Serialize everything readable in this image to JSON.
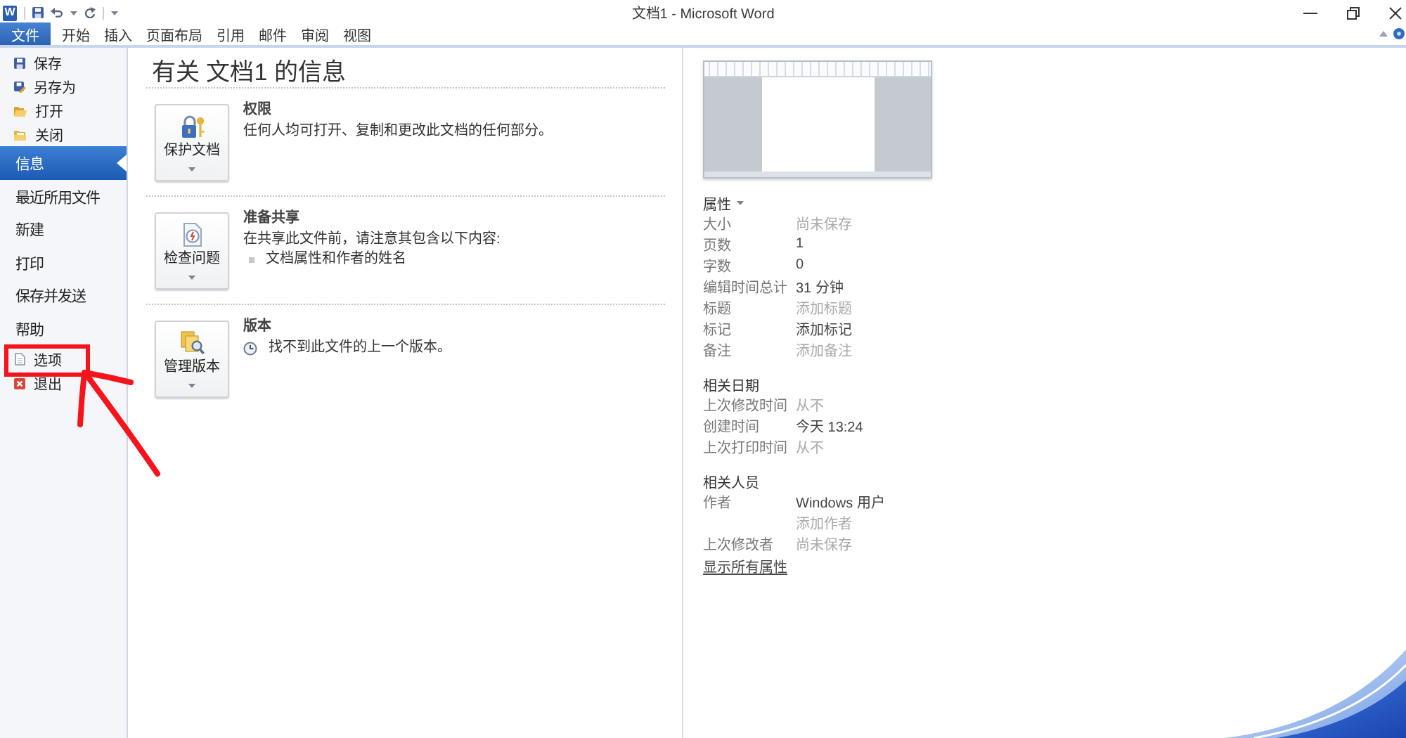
{
  "window": {
    "app_logo": "W",
    "title": "文档1 - Microsoft Word"
  },
  "ribbon_tabs": [
    {
      "label": "文件",
      "selected": true
    },
    {
      "label": "开始",
      "selected": false
    },
    {
      "label": "插入",
      "selected": false
    },
    {
      "label": "页面布局",
      "selected": false
    },
    {
      "label": "引用",
      "selected": false
    },
    {
      "label": "邮件",
      "selected": false
    },
    {
      "label": "审阅",
      "selected": false
    },
    {
      "label": "视图",
      "selected": false
    }
  ],
  "backstage_menu": [
    {
      "label": "保存",
      "kind": "save",
      "selected": false,
      "annotated": false
    },
    {
      "label": "另存为",
      "kind": "saveas",
      "selected": false,
      "annotated": false
    },
    {
      "label": "打开",
      "kind": "open",
      "selected": false,
      "annotated": false
    },
    {
      "label": "关闭",
      "kind": "close",
      "selected": false,
      "annotated": false
    },
    {
      "label": "信息",
      "kind": "page",
      "selected": true,
      "annotated": false
    },
    {
      "label": "最近所用文件",
      "kind": "page",
      "selected": false,
      "annotated": false
    },
    {
      "label": "新建",
      "kind": "page",
      "selected": false,
      "annotated": false
    },
    {
      "label": "打印",
      "kind": "page",
      "selected": false,
      "annotated": false
    },
    {
      "label": "保存并发送",
      "kind": "page",
      "selected": false,
      "annotated": false
    },
    {
      "label": "帮助",
      "kind": "page",
      "selected": false,
      "annotated": false
    },
    {
      "label": "选项",
      "kind": "options",
      "selected": false,
      "annotated": true
    },
    {
      "label": "退出",
      "kind": "exit",
      "selected": false,
      "annotated": false
    }
  ],
  "info": {
    "title": "有关 文档1 的信息",
    "sections": [
      {
        "kind": "permissions",
        "button": "保护文档",
        "heading": "权限",
        "text": "任何人均可打开、复制和更改此文档的任何部分。"
      },
      {
        "kind": "inspect",
        "button": "检查问题",
        "heading": "准备共享",
        "text": "在共享此文件前，请注意其包含以下内容:",
        "bullets": [
          "文档属性和作者的姓名"
        ]
      },
      {
        "kind": "versions",
        "button": "管理版本",
        "heading": "版本",
        "note": "找不到此文件的上一个版本。"
      }
    ]
  },
  "properties": {
    "heading": "属性",
    "rows": [
      {
        "label": "大小",
        "value": "尚未保存",
        "dimmed": true
      },
      {
        "label": "页数",
        "value": "1",
        "dimmed": false
      },
      {
        "label": "字数",
        "value": "0",
        "dimmed": false
      },
      {
        "label": "编辑时间总计",
        "value": "31 分钟",
        "dimmed": false
      },
      {
        "label": "标题",
        "value": "添加标题",
        "dimmed": true
      },
      {
        "label": "标记",
        "value": "添加标记",
        "dimmed": false
      },
      {
        "label": "备注",
        "value": "添加备注",
        "dimmed": true
      }
    ]
  },
  "related_dates": {
    "heading": "相关日期",
    "rows": [
      {
        "label": "上次修改时间",
        "value": "从不",
        "dimmed": true
      },
      {
        "label": "创建时间",
        "value": "今天 13:24",
        "dimmed": false
      },
      {
        "label": "上次打印时间",
        "value": "从不",
        "dimmed": true
      }
    ]
  },
  "related_people": {
    "heading": "相关人员",
    "rows": [
      {
        "label": "作者",
        "value": "Windows 用户",
        "dimmed": false
      },
      {
        "value": "添加作者",
        "dimmed": true
      },
      {
        "label": "上次修改者",
        "value": "尚未保存",
        "dimmed": true
      }
    ]
  },
  "show_all_link": "显示所有属性"
}
